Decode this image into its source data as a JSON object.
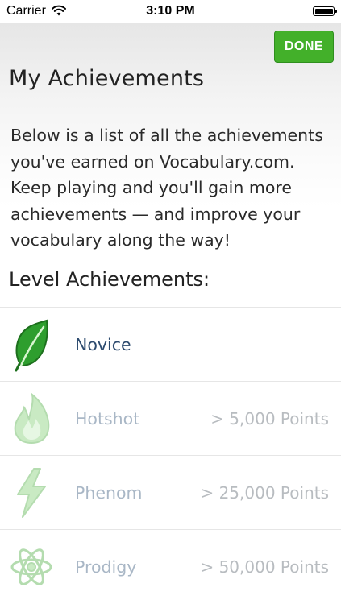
{
  "status_bar": {
    "carrier": "Carrier",
    "time": "3:10 PM",
    "wifi_icon": "wifi-icon",
    "battery_icon": "battery-icon"
  },
  "header": {
    "done_label": "DONE",
    "title": "My Achievements"
  },
  "intro": {
    "text": "Below is a list of all the achievements you've earned on Vocabulary.com. Keep playing and you'll gain more achievements — and improve your vocabulary along the way!"
  },
  "section": {
    "title": "Level Achievements:"
  },
  "achievements": [
    {
      "name": "Novice",
      "points": "",
      "icon": "leaf-icon",
      "earned": true
    },
    {
      "name": "Hotshot",
      "points": "> 5,000 Points",
      "icon": "flame-icon",
      "earned": false
    },
    {
      "name": "Phenom",
      "points": "> 25,000 Points",
      "icon": "lightning-bolt-icon",
      "earned": false
    },
    {
      "name": "Prodigy",
      "points": "> 50,000 Points",
      "icon": "atom-icon",
      "earned": false
    }
  ],
  "colors": {
    "accent_green": "#43b02a",
    "earned_text": "#2c4a6e",
    "locked_text": "#a9b7c6",
    "points_text": "#b8bcc0"
  }
}
